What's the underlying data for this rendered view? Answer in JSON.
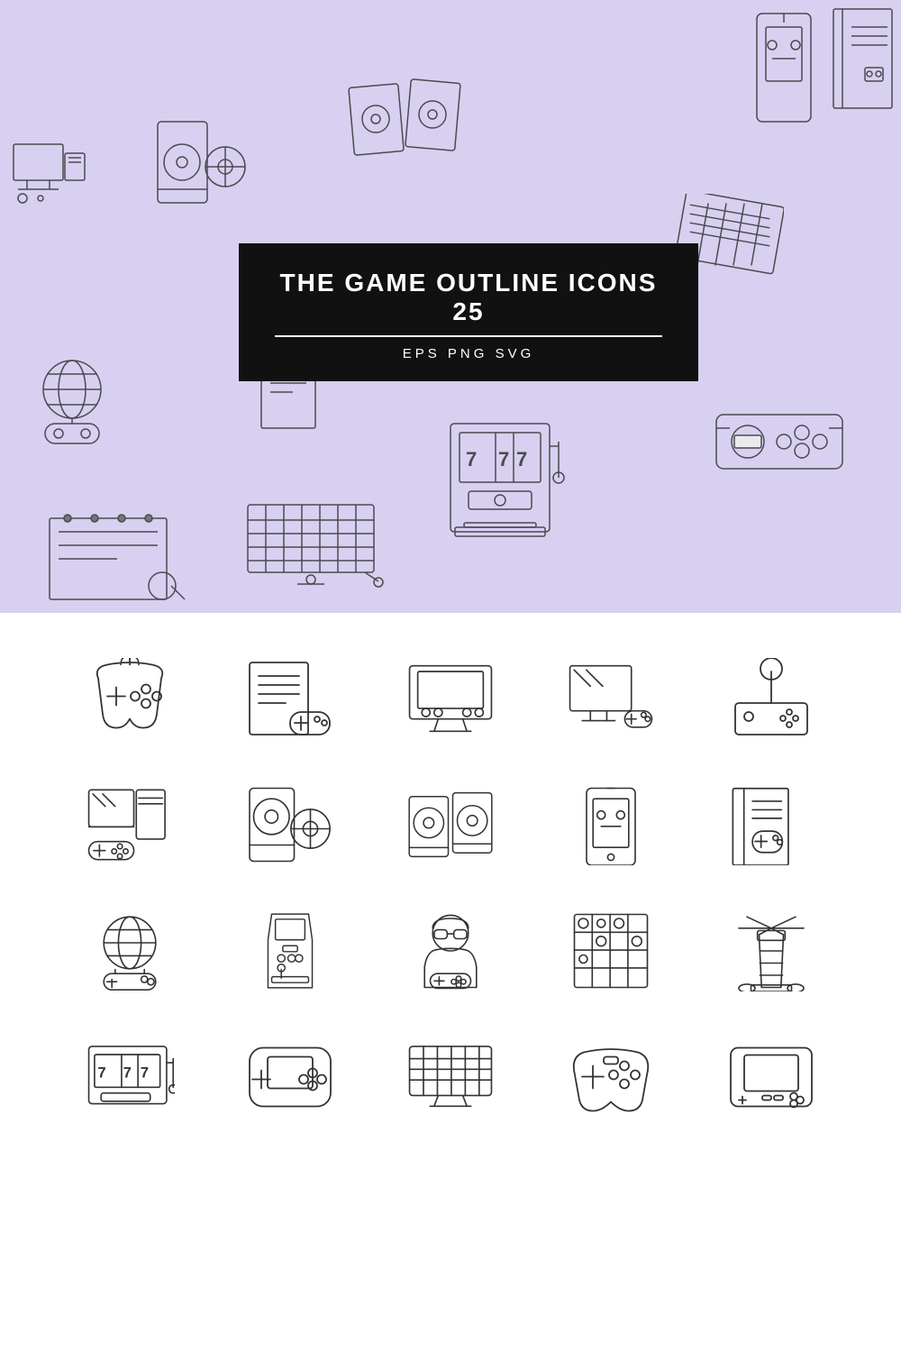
{
  "hero": {
    "bg_color": "#d8d0f0",
    "title": "THE GAME OUTLINE ICONS 25",
    "formats": "EPS   PNG   SVG"
  },
  "grid": {
    "icons": [
      "gamepad-classic",
      "game-script-controller",
      "arcade-monitor",
      "monitor-controller",
      "joystick",
      "pc-desktop-controller",
      "game-disc-phone",
      "dual-tablet-disc",
      "mobile-game",
      "book-controller",
      "globe-controller",
      "arcade-cabinet",
      "gamer-avatar",
      "chess-board",
      "lighthouse",
      "slot-machine-row",
      "handheld-gamepad",
      "keyboard-game",
      "game-pad-2",
      "game-gear-2"
    ]
  }
}
